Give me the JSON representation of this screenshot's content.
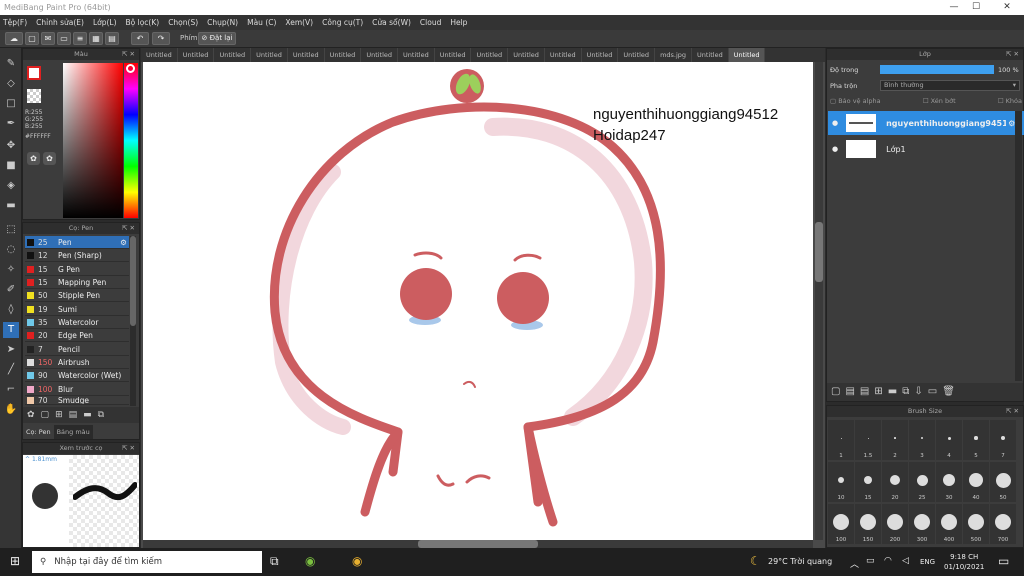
{
  "app": {
    "title": "MediBang Paint Pro (64bit)"
  },
  "window_controls": {
    "minimize": "—",
    "maximize": "☐",
    "close": "✕"
  },
  "menu": [
    "Tệp(F)",
    "Chỉnh sửa(E)",
    "Lớp(L)",
    "Bộ lọc(K)",
    "Chọn(S)",
    "Chụp(N)",
    "Màu (C)",
    "Xem(V)",
    "Công cụ(T)",
    "Cửa sổ(W)",
    "Cloud",
    "Help"
  ],
  "toolbar": {
    "phim_label": "Phím",
    "reset_label": "Đặt lại"
  },
  "color_panel": {
    "title": "Màu",
    "values": [
      "R:255",
      "G:255",
      "B:255"
    ],
    "hex": "#FFFFFF"
  },
  "brush_panel": {
    "title": "Cọ: Pen",
    "brushes": [
      {
        "size": "25",
        "name": "Pen",
        "color": "#111111"
      },
      {
        "size": "12",
        "name": "Pen (Sharp)",
        "color": "#111111"
      },
      {
        "size": "15",
        "name": "G Pen",
        "color": "#e02020"
      },
      {
        "size": "15",
        "name": "Mapping Pen",
        "color": "#e02020"
      },
      {
        "size": "50",
        "name": "Stipple Pen",
        "color": "#f0e020"
      },
      {
        "size": "19",
        "name": "Sumi",
        "color": "#f0e020"
      },
      {
        "size": "35",
        "name": "Watercolor",
        "color": "#6fc8e8"
      },
      {
        "size": "20",
        "name": "Edge Pen",
        "color": "#e02020"
      },
      {
        "size": "7",
        "name": "Pencil",
        "color": "#222222"
      },
      {
        "size": "150",
        "name": "Airbrush",
        "color": "#dddddd"
      },
      {
        "size": "90",
        "name": "Watercolor (Wet)",
        "color": "#6fc8e8"
      },
      {
        "size": "100",
        "name": "Blur",
        "color": "#f0a8c8"
      },
      {
        "size": "70",
        "name": "Smudge",
        "color": "#f0c8a8"
      }
    ],
    "tabs": [
      "Cọ: Pen",
      "Bảng màu"
    ]
  },
  "preview_panel": {
    "title": "Xem trước cọ",
    "size": "1.81mm"
  },
  "doc_tabs": [
    "Untitled",
    "Untitled",
    "Untitled",
    "Untitled",
    "Untitled",
    "Untitled",
    "Untitled",
    "Untitled",
    "Untitled",
    "Untitled",
    "Untitled",
    "Untitled",
    "Untitled",
    "Untitled",
    "mds.jpg",
    "Untitled",
    "Untitled"
  ],
  "canvas_text": {
    "line1": "nguyenthihuonggiang94512",
    "line2": "Hoidap247"
  },
  "layer_panel": {
    "title": "Lớp",
    "opacity_label": "Độ trong",
    "opacity_value": "100 %",
    "opacity": 1.0,
    "blend_label": "Pha trộn",
    "blend_value": "Bình thường",
    "options": [
      "Bảo vệ alpha",
      "Xén bớt",
      "Khóa"
    ],
    "layers": [
      {
        "name": "nguyenthihuonggiang94512"
      },
      {
        "name": "Lớp1"
      }
    ]
  },
  "brush_size_panel": {
    "title": "Brush Size",
    "sizes": [
      "1",
      "1.5",
      "2",
      "3",
      "4",
      "5",
      "7",
      "10",
      "15",
      "20",
      "25",
      "30",
      "40",
      "50",
      "100",
      "150",
      "200",
      "300",
      "400",
      "500",
      "700"
    ]
  },
  "taskbar": {
    "search_placeholder": "Nhập tại đây để tìm kiếm",
    "weather": "29°C  Trời quang",
    "lang": "ENG",
    "time": "9:18 CH",
    "date": "01/10/2021"
  }
}
